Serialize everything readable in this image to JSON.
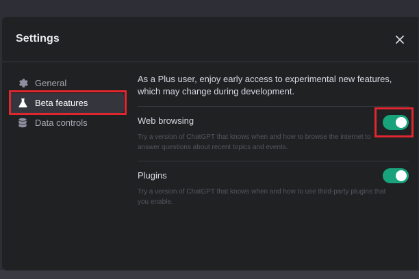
{
  "modal": {
    "title": "Settings"
  },
  "sidebar": {
    "items": [
      {
        "label": "General",
        "icon": "gear-icon"
      },
      {
        "label": "Beta features",
        "icon": "flask-icon",
        "active": true
      },
      {
        "label": "Data controls",
        "icon": "database-icon"
      }
    ]
  },
  "content": {
    "intro": "As a Plus user, enjoy early access to experimental new features, which may change during development.",
    "features": [
      {
        "title": "Web browsing",
        "description": "Try a version of ChatGPT that knows when and how to browse the internet to answer questions about recent topics and events.",
        "enabled": true
      },
      {
        "title": "Plugins",
        "description": "Try a version of ChatGPT that knows when and how to use third-party plugins that you enable.",
        "enabled": true
      }
    ]
  },
  "colors": {
    "toggle_on": "#19a37c",
    "highlight": "#e0262f",
    "modal_bg": "#202123"
  }
}
